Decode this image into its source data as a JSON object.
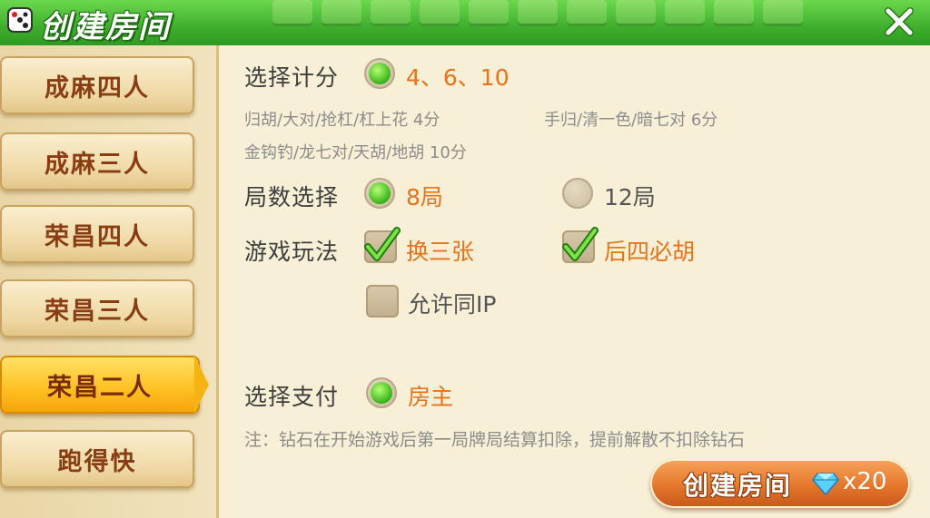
{
  "header": {
    "title": "创建房间"
  },
  "sidebar": {
    "tabs": [
      {
        "label": "成麻四人"
      },
      {
        "label": "成麻三人"
      },
      {
        "label": "荣昌四人"
      },
      {
        "label": "荣昌三人"
      },
      {
        "label": "荣昌二人",
        "active": true
      },
      {
        "label": "跑得快"
      }
    ]
  },
  "scoring": {
    "label": "选择计分",
    "option": "4、6、10",
    "note1": "归胡/大对/抢杠/杠上花 4分",
    "note2": "手归/清一色/暗七对 6分",
    "note3": "金钩钓/龙七对/天胡/地胡 10分"
  },
  "rounds": {
    "label": "局数选择",
    "options": [
      "8局",
      "12局"
    ],
    "selected": 0
  },
  "rules": {
    "label": "游戏玩法",
    "options": [
      {
        "label": "换三张",
        "checked": true
      },
      {
        "label": "后四必胡",
        "checked": true
      },
      {
        "label": "允许同IP",
        "checked": false
      }
    ]
  },
  "payment": {
    "label": "选择支付",
    "option": "房主"
  },
  "note": "注：钻石在开始游戏后第一局牌局结算扣除，提前解散不扣除钻石",
  "create_button": {
    "label": "创建房间",
    "cost": "x20"
  },
  "colors": {
    "accent": "#e7731a",
    "header": "#3fae2c",
    "active_tab": "#ffbf1f"
  },
  "icons": {
    "dice": "dice-icon",
    "close": "close-icon",
    "gem": "diamond-icon",
    "check": "checkmark-icon"
  }
}
